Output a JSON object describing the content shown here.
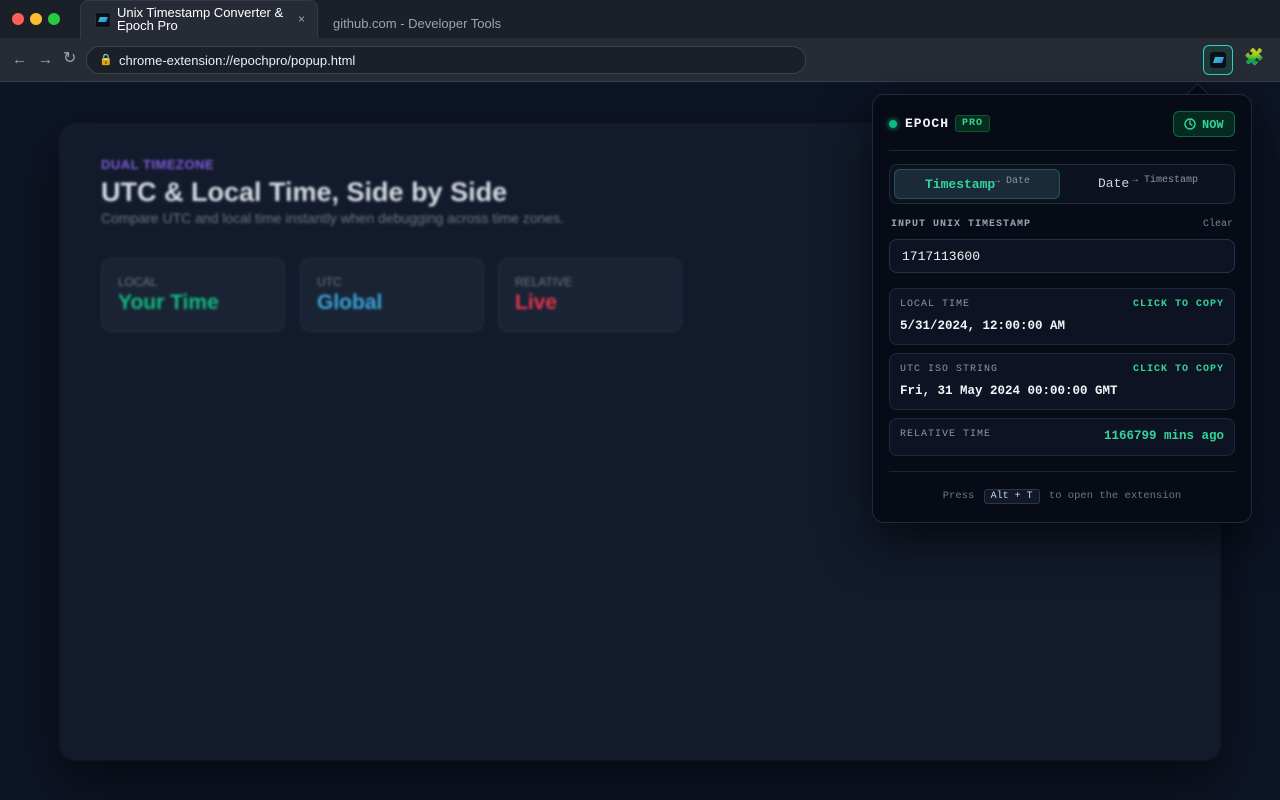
{
  "browser": {
    "active_tab": {
      "title": "Unix Timestamp Converter & Epoch Pro",
      "close_glyph": "×"
    },
    "inactive_tab": {
      "title": "github.com - Developer Tools"
    },
    "nav": {
      "back": "←",
      "forward": "→",
      "reload": "↻"
    },
    "address_bar": {
      "url": "chrome-extension://epochpro/popup.html",
      "lock_glyph": "🔒"
    },
    "extensions_glyph": "🧩"
  },
  "background_page": {
    "eyebrow": "DUAL TIMEZONE",
    "title": "UTC & Local Time, Side by Side",
    "subtitle": "Compare UTC and local time instantly when debugging across time zones.",
    "cards": [
      {
        "label": "LOCAL",
        "value": "Your Time",
        "color": "#10b981"
      },
      {
        "label": "UTC",
        "value": "Global",
        "color": "#38a3d9"
      },
      {
        "label": "RELATIVE",
        "value": "Live",
        "color": "#e0344f"
      }
    ]
  },
  "popup": {
    "brand": "EPOCH",
    "badge": "PRO",
    "now_button": "NOW",
    "mode_tabs": [
      {
        "main": "Timestamp",
        "sub": "→ Date",
        "active": true
      },
      {
        "main": "Date",
        "sub": "→ Timestamp",
        "active": false
      }
    ],
    "input_label": "INPUT UNIX TIMESTAMP",
    "clear_label": "Clear",
    "input_value": "1717113600",
    "local_time": {
      "label": "LOCAL TIME",
      "copy": "CLICK TO COPY",
      "value": "5/31/2024, 12:00:00 AM"
    },
    "utc_iso": {
      "label": "UTC ISO STRING",
      "copy": "CLICK TO COPY",
      "value": "Fri, 31 May 2024 00:00:00 GMT"
    },
    "relative": {
      "label": "RELATIVE TIME",
      "value": "1166799 mins ago"
    },
    "footer": {
      "prefix": "Press",
      "shortcut": "Alt + T",
      "suffix": "to open the extension"
    }
  },
  "colors": {
    "accent": "#34d399",
    "background": "#0d1424",
    "popup_bg": "#070b16"
  }
}
